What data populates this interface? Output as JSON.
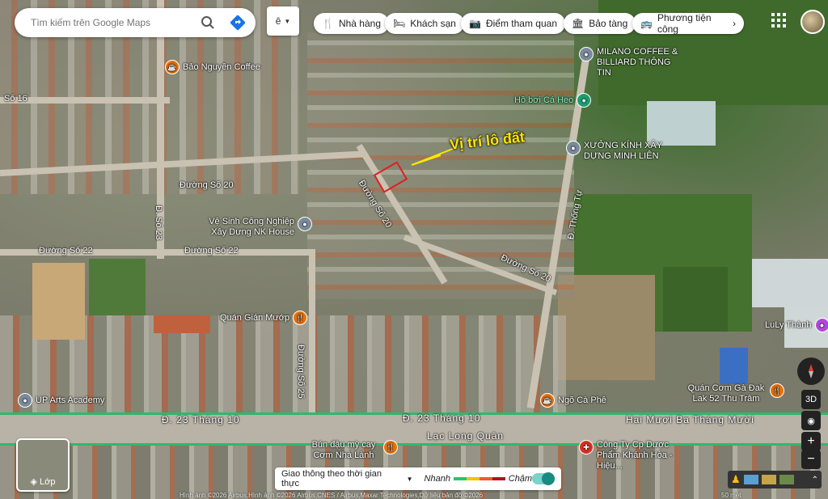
{
  "search": {
    "placeholder": "Tìm kiếm trên Google Maps"
  },
  "language_btn": "ê",
  "chips": [
    {
      "label": "Nhà hàng",
      "icon": "restaurant-icon"
    },
    {
      "label": "Khách sạn",
      "icon": "hotel-icon"
    },
    {
      "label": "Điểm tham quan",
      "icon": "camera-icon"
    },
    {
      "label": "Bảo tàng",
      "icon": "museum-icon"
    },
    {
      "label": "Phương tiện công",
      "icon": "transit-icon"
    }
  ],
  "annotation": {
    "label": "Vị trí lô đất",
    "color": "#ffe600",
    "box_color": "#e02020"
  },
  "roads": {
    "so16": "Số 16",
    "so20a": "Đường Số 20",
    "so20b": "Đường Số 20",
    "so20c": "Đường Số 20",
    "so22a": "Đường Số 22",
    "so22b": "Đường Số 22",
    "so23": "Đ. Số 23",
    "so25": "Đường Số 25",
    "thongtu": "Đ. Thống Tự",
    "thang10a": "Đ. 23 Tháng 10",
    "thang10b": "Đ. 23 Tháng 10",
    "thang10c": "Hai Mươi Ba Tháng Mười",
    "laclongquan": "Lạc Long Quân"
  },
  "pois": [
    {
      "name": "Bảo Nguyên Coffee",
      "color": "#e8710a",
      "glyph": "☕"
    },
    {
      "name": "MILANO COFFEE & BILLIARD THÔNG TIN",
      "color": "#7a8a9a",
      "glyph": "●"
    },
    {
      "name": "Hồ bơi Cá Heo",
      "color": "#1a9e6e",
      "glyph": "●"
    },
    {
      "name": "XƯỞNG KÍNH XÂY DỰNG MINH LIÊN",
      "color": "#7a8a9a",
      "glyph": "●"
    },
    {
      "name": "Vệ Sinh Công Nghiệp Xây Dựng NK House",
      "color": "#7a8a9a",
      "glyph": "●"
    },
    {
      "name": "Quán Gián Mướp",
      "color": "#e8710a",
      "glyph": "🍴"
    },
    {
      "name": "UP Arts Academy",
      "color": "#7a8a9a",
      "glyph": "●"
    },
    {
      "name": "Ngõ Cà Phê",
      "color": "#e8710a",
      "glyph": "☕"
    },
    {
      "name": "Quán Cơm Gà Đak Lak 52 Thu Trâm",
      "color": "#e8710a",
      "glyph": "🍴"
    },
    {
      "name": "LuLy Thành",
      "color": "#b04ad6",
      "glyph": "●"
    },
    {
      "name": "Bún đậu mỳ cay Cơm Nhà Lành",
      "color": "#e8710a",
      "glyph": "🍴"
    },
    {
      "name": "Công Ty Cp Dược Phẩm Khánh Hòa - Hiệu...",
      "color": "#d93025",
      "glyph": "✚"
    }
  ],
  "layer_btn": "Lớp",
  "traffic": {
    "label": "Giao thông theo thời gian thực",
    "fast": "Nhanh",
    "slow": "Chậm"
  },
  "controls": {
    "view3d": "3D",
    "zoom_in": "+",
    "zoom_out": "−"
  },
  "scale": "50 mét",
  "attribution": "Hình ảnh ©2026 Airbus,Hình ảnh ©2026 Airbus,CNES / Airbus,Maxar Technologies,Dữ liệu bản đồ ©2026"
}
